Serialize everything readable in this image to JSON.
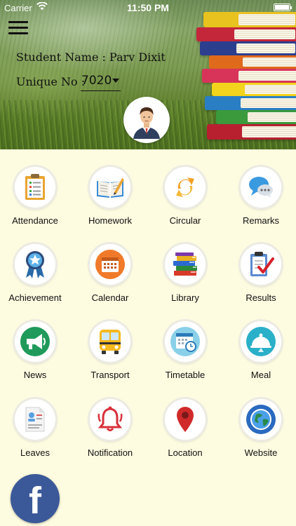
{
  "status_bar": {
    "carrier": "Carrier",
    "time": "11:50 PM"
  },
  "header": {
    "student_name": "Student Name : Parv Dixit",
    "unique_label": "Unique No :",
    "unique_value": "7020"
  },
  "menu": [
    {
      "id": "attendance",
      "label": "Attendance",
      "icon": "clipboard-checklist-icon"
    },
    {
      "id": "homework",
      "label": "Homework",
      "icon": "open-book-pencil-icon"
    },
    {
      "id": "circular",
      "label": "Circular",
      "icon": "circular-arrows-icon"
    },
    {
      "id": "remarks",
      "label": "Remarks",
      "icon": "speech-bubble-icon"
    },
    {
      "id": "achievement",
      "label": "Achievement",
      "icon": "medal-ribbon-icon"
    },
    {
      "id": "calendar",
      "label": "Calendar",
      "icon": "calendar-icon"
    },
    {
      "id": "library",
      "label": "Library",
      "icon": "book-stack-icon"
    },
    {
      "id": "results",
      "label": "Results",
      "icon": "results-clipboard-icon"
    },
    {
      "id": "news",
      "label": "News",
      "icon": "megaphone-icon"
    },
    {
      "id": "transport",
      "label": "Transport",
      "icon": "school-bus-icon"
    },
    {
      "id": "timetable",
      "label": "Timetable",
      "icon": "calendar-clock-icon"
    },
    {
      "id": "meal",
      "label": "Meal",
      "icon": "food-cloche-icon"
    },
    {
      "id": "leaves",
      "label": "Leaves",
      "icon": "leave-form-icon"
    },
    {
      "id": "notification",
      "label": "Notification",
      "icon": "bell-icon"
    },
    {
      "id": "location",
      "label": "Location",
      "icon": "map-pin-icon"
    },
    {
      "id": "website",
      "label": "Website",
      "icon": "globe-icon"
    }
  ],
  "social": {
    "facebook_glyph": "f"
  },
  "colors": {
    "background": "#fdfbe0",
    "facebook": "#3b5998"
  }
}
